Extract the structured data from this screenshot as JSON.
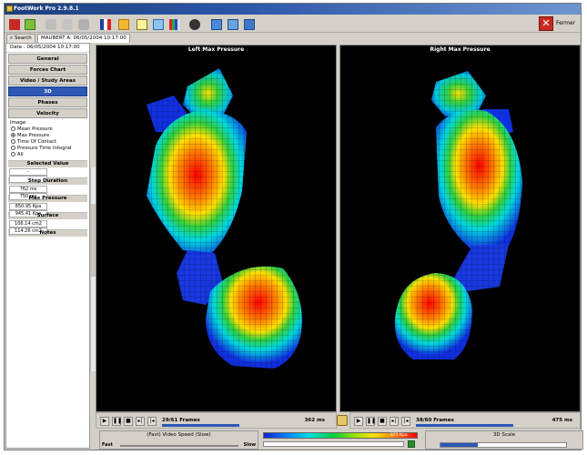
{
  "window": {
    "title": "FootWork Pro 2.9.8.1"
  },
  "toolbar": {
    "close_label": "Fermer"
  },
  "tabs": [
    {
      "label": "Search"
    },
    {
      "label": "MAUBERT A: 06/05/2004 10:17:00"
    }
  ],
  "sidebar": {
    "date": "Date : 06/05/2004 10:17:00",
    "nav": [
      "General",
      "Forces Chart",
      "Video / Study Areas",
      "3D",
      "Phases",
      "Velocity"
    ],
    "active_nav": "3D",
    "image_label": "Image",
    "image_options": [
      "Mean Pressure",
      "Max Pressure",
      "Time Of Contact",
      "Pressure Time Integral",
      "All"
    ],
    "image_selected": "Max Pressure",
    "selected_value": {
      "label": "Selected Value",
      "left": "-",
      "right": "-"
    },
    "step_duration": {
      "label": "Step Duration",
      "left": "762 ms",
      "right": "750 ms"
    },
    "max_pressure": {
      "label": "Max Pressure",
      "left": "850.95 Kpa",
      "right": "945.41 Kpa"
    },
    "surface": {
      "label": "Surface",
      "left": "106.14 cm2",
      "right": "114.26 cm2"
    },
    "notes_label": "Notes"
  },
  "views": {
    "left": {
      "title": "Left Max Pressure",
      "frames": "29/61 Frames",
      "time": "362 ms",
      "progress": 0.47
    },
    "right": {
      "title": "Right Max Pressure",
      "frames": "38/60 Frames",
      "time": "475 ms",
      "progress": 0.63
    }
  },
  "bottom": {
    "speed_title": "(Fast)  Video Speed  (Slow)",
    "fast_label": "Fast",
    "slow_label": "Slow",
    "scale_max": "875 Kpa",
    "scale_3d_title": "3D Scale",
    "scale_3d_level": 0.3
  },
  "colors": {
    "active_nav": "#2c57b5",
    "title_bar": "#1d3f7c",
    "view_bg": "#000000",
    "close_button": "#c62a22"
  },
  "icons": {
    "close": "close-icon",
    "lock": "lock-icon",
    "play": "play-icon",
    "pause": "pause-icon",
    "stop": "stop-icon",
    "step_forward": "step-forward-icon",
    "step_back": "step-back-icon"
  }
}
